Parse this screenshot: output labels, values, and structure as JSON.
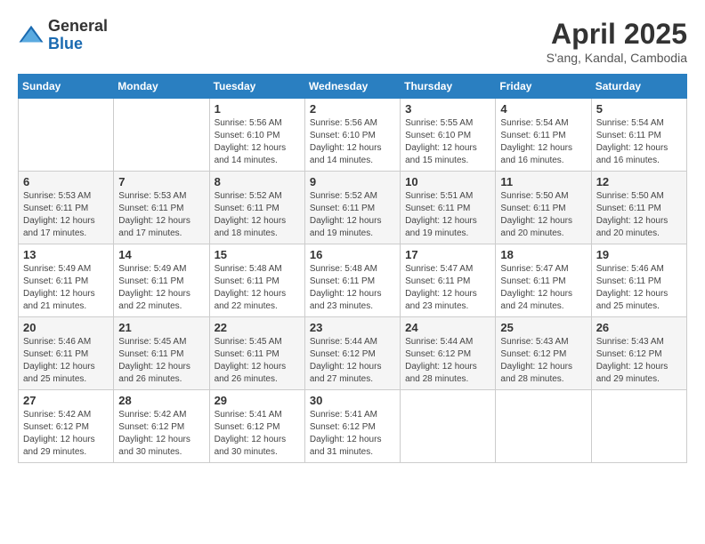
{
  "header": {
    "logo_general": "General",
    "logo_blue": "Blue",
    "month_title": "April 2025",
    "location": "S'ang, Kandal, Cambodia"
  },
  "days_of_week": [
    "Sunday",
    "Monday",
    "Tuesday",
    "Wednesday",
    "Thursday",
    "Friday",
    "Saturday"
  ],
  "weeks": [
    {
      "shaded": false,
      "days": [
        {
          "number": "",
          "info": ""
        },
        {
          "number": "",
          "info": ""
        },
        {
          "number": "1",
          "info": "Sunrise: 5:56 AM\nSunset: 6:10 PM\nDaylight: 12 hours and 14 minutes."
        },
        {
          "number": "2",
          "info": "Sunrise: 5:56 AM\nSunset: 6:10 PM\nDaylight: 12 hours and 14 minutes."
        },
        {
          "number": "3",
          "info": "Sunrise: 5:55 AM\nSunset: 6:10 PM\nDaylight: 12 hours and 15 minutes."
        },
        {
          "number": "4",
          "info": "Sunrise: 5:54 AM\nSunset: 6:11 PM\nDaylight: 12 hours and 16 minutes."
        },
        {
          "number": "5",
          "info": "Sunrise: 5:54 AM\nSunset: 6:11 PM\nDaylight: 12 hours and 16 minutes."
        }
      ]
    },
    {
      "shaded": true,
      "days": [
        {
          "number": "6",
          "info": "Sunrise: 5:53 AM\nSunset: 6:11 PM\nDaylight: 12 hours and 17 minutes."
        },
        {
          "number": "7",
          "info": "Sunrise: 5:53 AM\nSunset: 6:11 PM\nDaylight: 12 hours and 17 minutes."
        },
        {
          "number": "8",
          "info": "Sunrise: 5:52 AM\nSunset: 6:11 PM\nDaylight: 12 hours and 18 minutes."
        },
        {
          "number": "9",
          "info": "Sunrise: 5:52 AM\nSunset: 6:11 PM\nDaylight: 12 hours and 19 minutes."
        },
        {
          "number": "10",
          "info": "Sunrise: 5:51 AM\nSunset: 6:11 PM\nDaylight: 12 hours and 19 minutes."
        },
        {
          "number": "11",
          "info": "Sunrise: 5:50 AM\nSunset: 6:11 PM\nDaylight: 12 hours and 20 minutes."
        },
        {
          "number": "12",
          "info": "Sunrise: 5:50 AM\nSunset: 6:11 PM\nDaylight: 12 hours and 20 minutes."
        }
      ]
    },
    {
      "shaded": false,
      "days": [
        {
          "number": "13",
          "info": "Sunrise: 5:49 AM\nSunset: 6:11 PM\nDaylight: 12 hours and 21 minutes."
        },
        {
          "number": "14",
          "info": "Sunrise: 5:49 AM\nSunset: 6:11 PM\nDaylight: 12 hours and 22 minutes."
        },
        {
          "number": "15",
          "info": "Sunrise: 5:48 AM\nSunset: 6:11 PM\nDaylight: 12 hours and 22 minutes."
        },
        {
          "number": "16",
          "info": "Sunrise: 5:48 AM\nSunset: 6:11 PM\nDaylight: 12 hours and 23 minutes."
        },
        {
          "number": "17",
          "info": "Sunrise: 5:47 AM\nSunset: 6:11 PM\nDaylight: 12 hours and 23 minutes."
        },
        {
          "number": "18",
          "info": "Sunrise: 5:47 AM\nSunset: 6:11 PM\nDaylight: 12 hours and 24 minutes."
        },
        {
          "number": "19",
          "info": "Sunrise: 5:46 AM\nSunset: 6:11 PM\nDaylight: 12 hours and 25 minutes."
        }
      ]
    },
    {
      "shaded": true,
      "days": [
        {
          "number": "20",
          "info": "Sunrise: 5:46 AM\nSunset: 6:11 PM\nDaylight: 12 hours and 25 minutes."
        },
        {
          "number": "21",
          "info": "Sunrise: 5:45 AM\nSunset: 6:11 PM\nDaylight: 12 hours and 26 minutes."
        },
        {
          "number": "22",
          "info": "Sunrise: 5:45 AM\nSunset: 6:11 PM\nDaylight: 12 hours and 26 minutes."
        },
        {
          "number": "23",
          "info": "Sunrise: 5:44 AM\nSunset: 6:12 PM\nDaylight: 12 hours and 27 minutes."
        },
        {
          "number": "24",
          "info": "Sunrise: 5:44 AM\nSunset: 6:12 PM\nDaylight: 12 hours and 28 minutes."
        },
        {
          "number": "25",
          "info": "Sunrise: 5:43 AM\nSunset: 6:12 PM\nDaylight: 12 hours and 28 minutes."
        },
        {
          "number": "26",
          "info": "Sunrise: 5:43 AM\nSunset: 6:12 PM\nDaylight: 12 hours and 29 minutes."
        }
      ]
    },
    {
      "shaded": false,
      "days": [
        {
          "number": "27",
          "info": "Sunrise: 5:42 AM\nSunset: 6:12 PM\nDaylight: 12 hours and 29 minutes."
        },
        {
          "number": "28",
          "info": "Sunrise: 5:42 AM\nSunset: 6:12 PM\nDaylight: 12 hours and 30 minutes."
        },
        {
          "number": "29",
          "info": "Sunrise: 5:41 AM\nSunset: 6:12 PM\nDaylight: 12 hours and 30 minutes."
        },
        {
          "number": "30",
          "info": "Sunrise: 5:41 AM\nSunset: 6:12 PM\nDaylight: 12 hours and 31 minutes."
        },
        {
          "number": "",
          "info": ""
        },
        {
          "number": "",
          "info": ""
        },
        {
          "number": "",
          "info": ""
        }
      ]
    }
  ]
}
